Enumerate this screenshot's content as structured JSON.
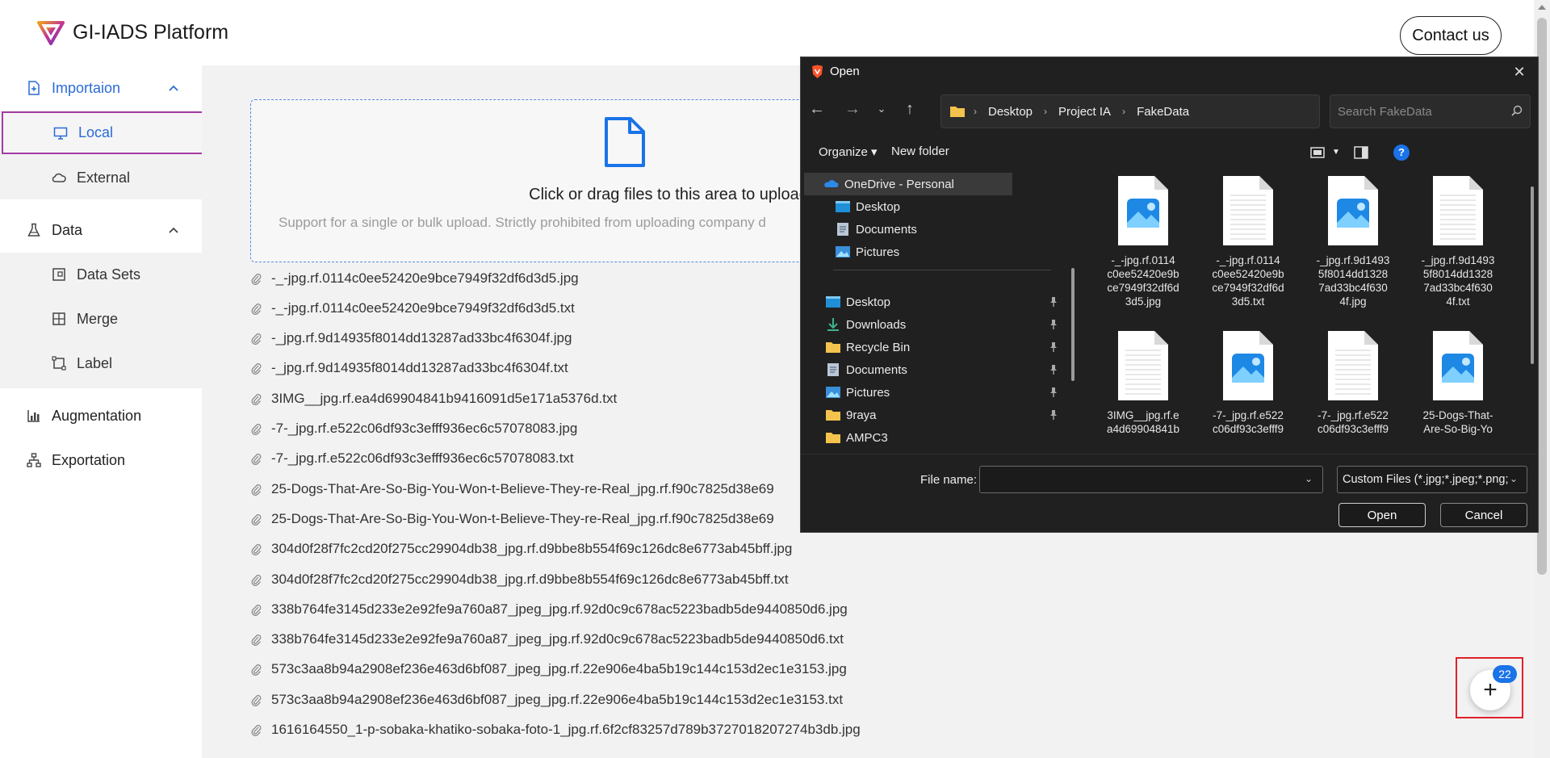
{
  "app": {
    "brand": "GI-IADS Platform",
    "contact_label": "Contact us"
  },
  "sidebar": {
    "importation": {
      "label": "Importaion",
      "icon": "file-import-icon"
    },
    "local": {
      "label": "Local",
      "icon": "monitor-icon"
    },
    "external": {
      "label": "External",
      "icon": "cloud-icon"
    },
    "data": {
      "label": "Data",
      "icon": "flask-icon"
    },
    "data_sets": {
      "label": "Data Sets",
      "icon": "dataset-icon"
    },
    "merge": {
      "label": "Merge",
      "icon": "merge-icon"
    },
    "label": {
      "label": "Label",
      "icon": "label-icon"
    },
    "augmentation": {
      "label": "Augmentation",
      "icon": "bar-chart-icon"
    },
    "exportation": {
      "label": "Exportation",
      "icon": "sitemap-icon"
    }
  },
  "upload": {
    "title": "Click or drag files to this area to upload",
    "hint": "Support for a single or bulk upload. Strictly prohibited from uploading company d"
  },
  "files": [
    "-_-jpg.rf.0114c0ee52420e9bce7949f32df6d3d5.jpg",
    "-_-jpg.rf.0114c0ee52420e9bce7949f32df6d3d5.txt",
    "-_jpg.rf.9d14935f8014dd13287ad33bc4f6304f.jpg",
    "-_jpg.rf.9d14935f8014dd13287ad33bc4f6304f.txt",
    "3IMG__jpg.rf.ea4d69904841b9416091d5e171a5376d.txt",
    "-7-_jpg.rf.e522c06df93c3efff936ec6c57078083.jpg",
    "-7-_jpg.rf.e522c06df93c3efff936ec6c57078083.txt",
    "25-Dogs-That-Are-So-Big-You-Won-t-Believe-They-re-Real_jpg.rf.f90c7825d38e69",
    "25-Dogs-That-Are-So-Big-You-Won-t-Believe-They-re-Real_jpg.rf.f90c7825d38e69",
    "304d0f28f7fc2cd20f275cc29904db38_jpg.rf.d9bbe8b554f69c126dc8e6773ab45bff.jpg",
    "304d0f28f7fc2cd20f275cc29904db38_jpg.rf.d9bbe8b554f69c126dc8e6773ab45bff.txt",
    "338b764fe3145d233e2e92fe9a760a87_jpeg_jpg.rf.92d0c9c678ac5223badb5de9440850d6.jpg",
    "338b764fe3145d233e2e92fe9a760a87_jpeg_jpg.rf.92d0c9c678ac5223badb5de9440850d6.txt",
    "573c3aa8b94a2908ef236e463d6bf087_jpeg_jpg.rf.22e906e4ba5b19c144c153d2ec1e3153.jpg",
    "573c3aa8b94a2908ef236e463d6bf087_jpeg_jpg.rf.22e906e4ba5b19c144c153d2ec1e3153.txt",
    "1616164550_1-p-sobaka-khatiko-sobaka-foto-1_jpg.rf.6f2cf83257d789b3727018207274b3db.jpg"
  ],
  "fab": {
    "badge": "22",
    "symbol": "+"
  },
  "dialog": {
    "title": "Open",
    "close": "✕",
    "breadcrumb": [
      "Desktop",
      "Project IA",
      "FakeData"
    ],
    "search_placeholder": "Search FakeData",
    "organize": "Organize ▾",
    "new_folder": "New folder",
    "help": "?",
    "nav_items": [
      {
        "label": "OneDrive - Personal",
        "icon": "onedrive-icon"
      },
      {
        "label": "Desktop",
        "icon": "desktop-folder-icon"
      },
      {
        "label": "Documents",
        "icon": "documents-folder-icon"
      },
      {
        "label": "Pictures",
        "icon": "pictures-folder-icon"
      },
      {
        "label": "Desktop",
        "icon": "desktop-folder-icon"
      },
      {
        "label": "Downloads",
        "icon": "download-icon"
      },
      {
        "label": "Recycle Bin",
        "icon": "folder-icon"
      },
      {
        "label": "Documents",
        "icon": "documents-folder-icon"
      },
      {
        "label": "Pictures",
        "icon": "pictures-folder-icon"
      },
      {
        "label": "9raya",
        "icon": "folder-icon"
      },
      {
        "label": "AMPC3",
        "icon": "folder-icon"
      }
    ],
    "tiles": [
      {
        "name": "-_-jpg.rf.0114\nc0ee52420e9b\nce7949f32df6d\n3d5.jpg",
        "kind": "image"
      },
      {
        "name": "-_-jpg.rf.0114\nc0ee52420e9b\nce7949f32df6d\n3d5.txt",
        "kind": "text"
      },
      {
        "name": "-_jpg.rf.9d1493\n5f8014dd1328\n7ad33bc4f630\n4f.jpg",
        "kind": "image"
      },
      {
        "name": "-_jpg.rf.9d1493\n5f8014dd1328\n7ad33bc4f630\n4f.txt",
        "kind": "text"
      },
      {
        "name": "3IMG__jpg.rf.e\na4d69904841b",
        "kind": "text"
      },
      {
        "name": "-7-_jpg.rf.e522\nc06df93c3efff9",
        "kind": "image"
      },
      {
        "name": "-7-_jpg.rf.e522\nc06df93c3efff9",
        "kind": "text"
      },
      {
        "name": "25-Dogs-That-\nAre-So-Big-Yo",
        "kind": "image"
      }
    ],
    "file_name_label": "File name:",
    "file_name_value": "",
    "filter": "Custom Files (*.jpg;*.jpeg;*.png;",
    "open": "Open",
    "cancel": "Cancel"
  },
  "colors": {
    "accent": "#1a73e8",
    "active_outline": "#a43ca4",
    "fab_outline": "#e0212b",
    "dialog_bg": "#202020"
  }
}
